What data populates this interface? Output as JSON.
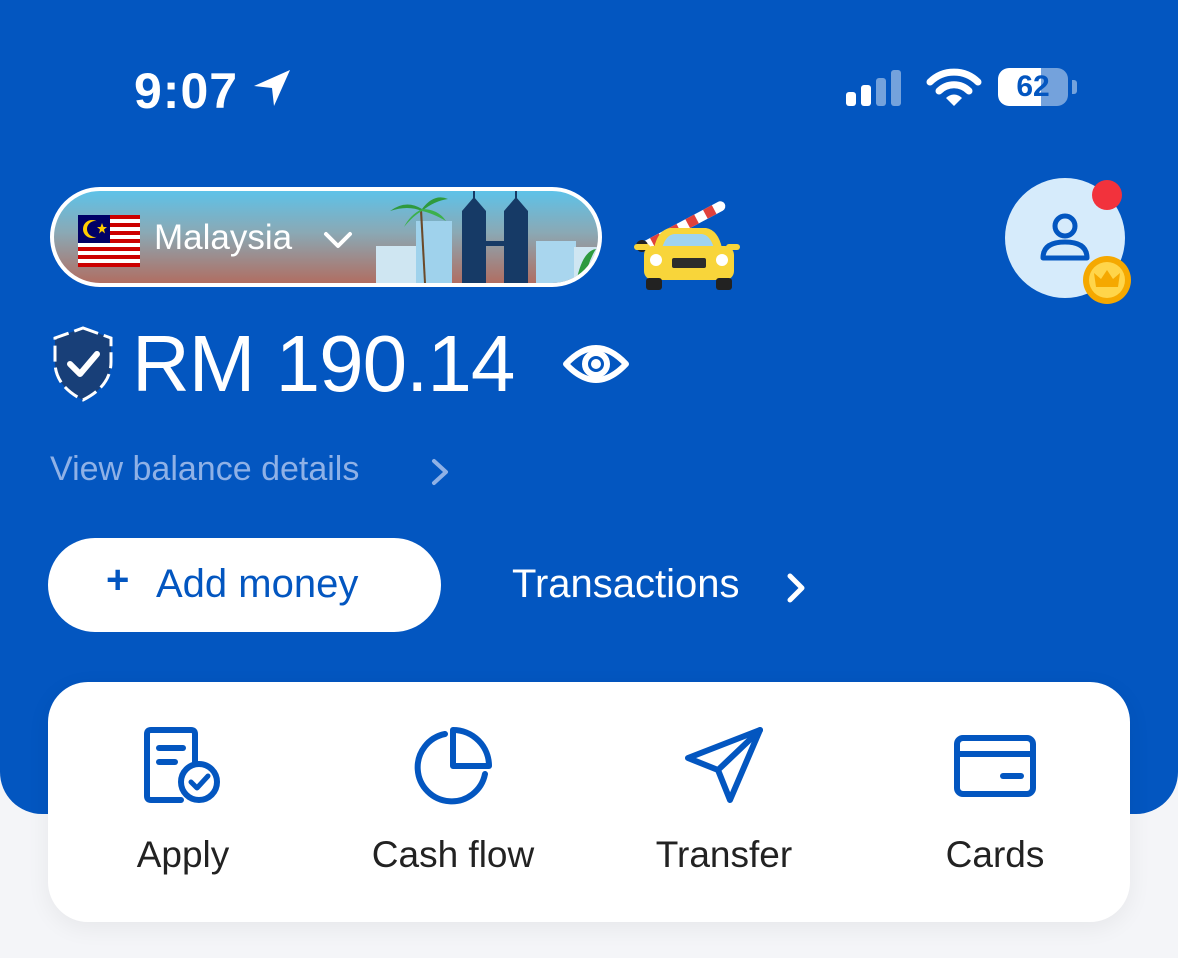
{
  "status_bar": {
    "time": "9:07",
    "battery": "62",
    "battery_level": 0.62,
    "icons": [
      "location-arrow-icon",
      "cellular-signal-icon",
      "wifi-icon",
      "battery-icon"
    ]
  },
  "header": {
    "country": "Malaysia",
    "balance": "RM 190.14",
    "view_balance_details": "View balance details",
    "add_money_plus": "+",
    "add_money": "Add money",
    "transactions": "Transactions"
  },
  "quick_actions": [
    {
      "label": "Apply",
      "icon": "apply-document-icon"
    },
    {
      "label": "Cash flow",
      "icon": "pie-chart-icon"
    },
    {
      "label": "Transfer",
      "icon": "send-icon"
    },
    {
      "label": "Cards",
      "icon": "card-icon"
    }
  ],
  "colors": {
    "brand_blue": "#0356c0",
    "notification": "#f2323c",
    "crown": "#f5a800"
  }
}
